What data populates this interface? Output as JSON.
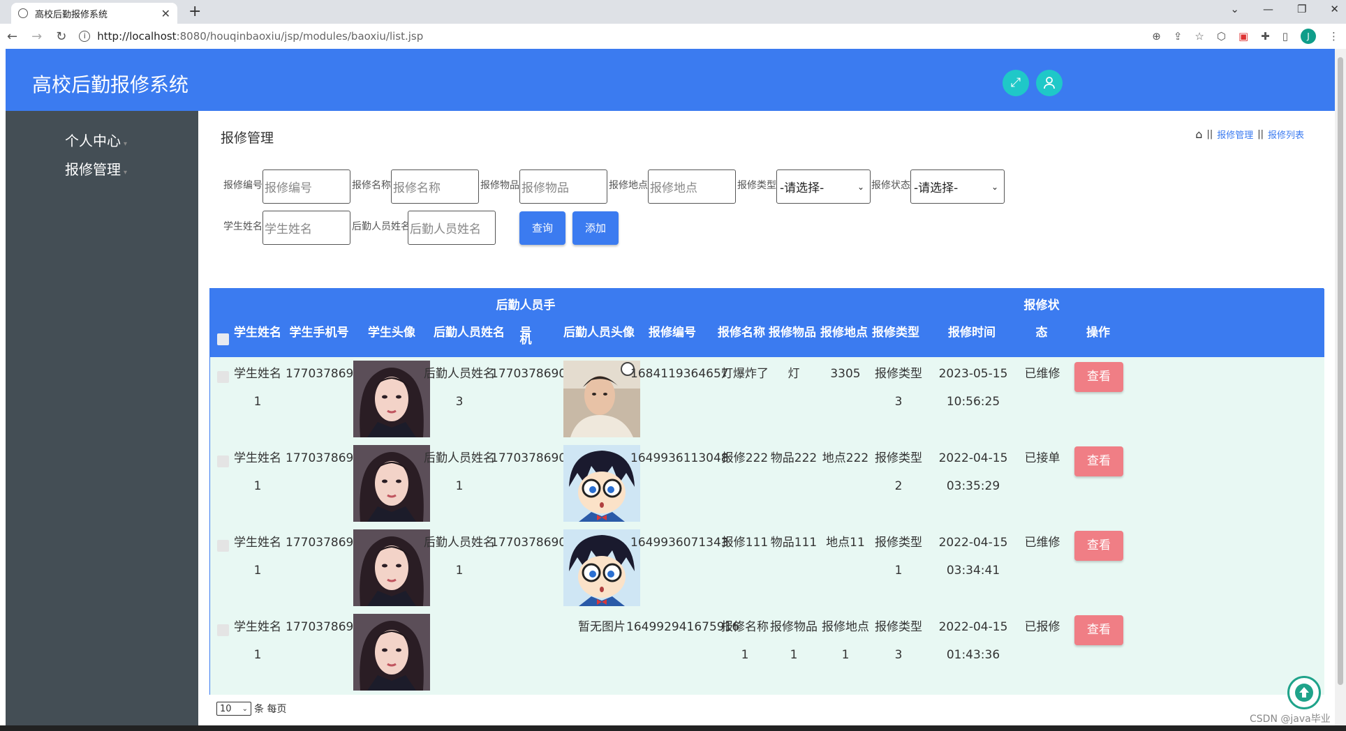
{
  "browser": {
    "tab_title": "高校后勤报修系统",
    "url_host": "http://localhost",
    "url_rest": ":8080/houqinbaoxiu/jsp/modules/baoxiu/list.jsp",
    "avatar_letter": "J"
  },
  "header": {
    "brand": "高校后勤报修系统",
    "accent": "#3b7bf0"
  },
  "sidebar": {
    "items": [
      {
        "label": "个人中心"
      },
      {
        "label": "报修管理"
      }
    ]
  },
  "page": {
    "title": "报修管理",
    "breadcrumb": {
      "item1": "报修管理",
      "item2": "报修列表"
    }
  },
  "filters": {
    "baoxiu_no": {
      "label": "报修编号",
      "placeholder": "报修编号"
    },
    "baoxiu_name": {
      "label": "报修名称",
      "placeholder": "报修名称"
    },
    "item": {
      "label": "报修物品",
      "placeholder": "报修物品"
    },
    "place": {
      "label": "报修地点",
      "placeholder": "报修地点"
    },
    "type": {
      "label": "报修类型",
      "value": "-请选择-"
    },
    "status": {
      "label": "报修状态",
      "value": "-请选择-"
    },
    "student": {
      "label": "学生姓名",
      "placeholder": "学生姓名"
    },
    "staff": {
      "label": "后勤人员姓名",
      "placeholder": "后勤人员姓名"
    },
    "query_label": "查询",
    "add_label": "添加"
  },
  "table": {
    "headers": {
      "student_name": "学生姓名",
      "student_phone": "学生手机号",
      "student_avatar": "学生头像",
      "staff_name": "后勤人员姓名",
      "staff_phone_1": "后勤人员手机",
      "staff_phone_2": "号",
      "staff_avatar": "后勤人员头像",
      "no": "报修编号",
      "name": "报修名称",
      "item": "报修物品",
      "place": "报修地点",
      "type": "报修类型",
      "time": "报修时间",
      "status_1": "报修状",
      "status_2": "态",
      "action": "操作"
    },
    "rows": [
      {
        "student_1": "学生姓名",
        "student_2": "1",
        "phone": "17703786901",
        "staff_1": "后勤人员姓名",
        "staff_2": "3",
        "staff_phone": "17703786903",
        "staff_avatar": "boy",
        "no": "1684119364657",
        "name_1": "灯爆炸了",
        "name_2": "",
        "item_1": "灯",
        "item_2": "",
        "place_1": "3305",
        "place_2": "",
        "type_1": "报修类型",
        "type_2": "3",
        "date": "2023-05-15",
        "time": "10:56:25",
        "status": "已维修",
        "action": "查看"
      },
      {
        "student_1": "学生姓名",
        "student_2": "1",
        "phone": "17703786901",
        "staff_1": "后勤人员姓名",
        "staff_2": "1",
        "staff_phone": "17703786901",
        "staff_avatar": "conan",
        "no": "1649936113048",
        "name_1": "报修222",
        "name_2": "",
        "item_1": "物品222",
        "item_2": "",
        "place_1": "地点222",
        "place_2": "",
        "type_1": "报修类型",
        "type_2": "2",
        "date": "2022-04-15",
        "time": "03:35:29",
        "status": "已接单",
        "action": "查看"
      },
      {
        "student_1": "学生姓名",
        "student_2": "1",
        "phone": "17703786901",
        "staff_1": "后勤人员姓名",
        "staff_2": "1",
        "staff_phone": "17703786901",
        "staff_avatar": "conan",
        "no": "1649936071343",
        "name_1": "报修111",
        "name_2": "",
        "item_1": "物品111",
        "item_2": "",
        "place_1": "地点11",
        "place_2": "",
        "type_1": "报修类型",
        "type_2": "1",
        "date": "2022-04-15",
        "time": "03:34:41",
        "status": "已维修",
        "action": "查看"
      },
      {
        "student_1": "学生姓名",
        "student_2": "1",
        "phone": "17703786901",
        "staff_1": "",
        "staff_2": "",
        "staff_phone": "",
        "staff_avatar": "none",
        "no_image_text": "暂无图片",
        "no": "164992941675916",
        "name_1": "报修名称",
        "name_2": "1",
        "item_1": "报修物品",
        "item_2": "1",
        "place_1": "报修地点",
        "place_2": "1",
        "type_1": "报修类型",
        "type_2": "3",
        "date": "2022-04-15",
        "time": "01:43:36",
        "status": "已报修",
        "action": "查看"
      }
    ]
  },
  "pager": {
    "size": "10",
    "unit": "条 每页"
  },
  "watermark": "CSDN @java毕业"
}
